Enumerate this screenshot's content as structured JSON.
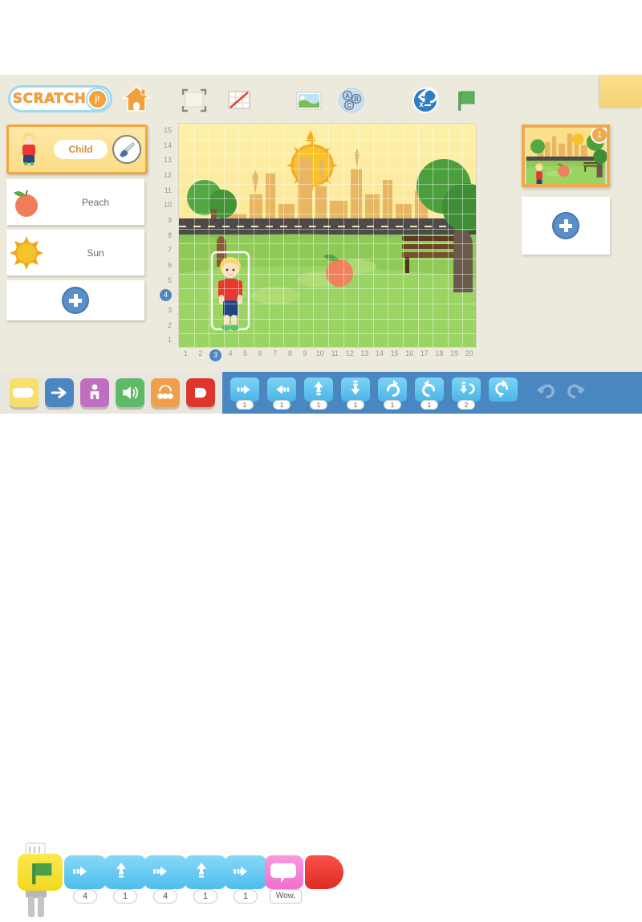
{
  "app": {
    "logo_text": "SCRATCH",
    "logo_badge": "jr"
  },
  "toolbar": {
    "home": "home-icon",
    "items": [
      {
        "name": "fullscreen-button",
        "icon": "fullscreen-icon"
      },
      {
        "name": "grid-toggle-button",
        "icon": "grid-icon"
      },
      {
        "name": "background-button",
        "icon": "image-icon"
      },
      {
        "name": "text-button",
        "icon": "abc-icon",
        "letters": [
          "A",
          "B",
          "C"
        ]
      },
      {
        "name": "reset-button",
        "icon": "reset-x-icon",
        "letter": "x"
      },
      {
        "name": "green-flag-button",
        "icon": "green-flag-icon"
      }
    ]
  },
  "characters": {
    "items": [
      {
        "name": "Child",
        "selected": true,
        "thumb": "boy-sprite"
      },
      {
        "name": "Peach",
        "selected": false,
        "thumb": "peach-sprite"
      },
      {
        "name": "Sun",
        "selected": false,
        "thumb": "sun-sprite"
      }
    ],
    "paint_icon": "paintbrush-icon",
    "add_label": "add-character-button"
  },
  "stage": {
    "x_axis": [
      "1",
      "2",
      "3",
      "4",
      "5",
      "6",
      "7",
      "8",
      "9",
      "10",
      "11",
      "12",
      "13",
      "14",
      "15",
      "16",
      "17",
      "18",
      "19",
      "20"
    ],
    "y_axis": [
      "15",
      "14",
      "13",
      "12",
      "11",
      "10",
      "9",
      "8",
      "7",
      "6",
      "5",
      "4",
      "3",
      "2",
      "1"
    ],
    "highlight_x": "3",
    "highlight_y": "4",
    "background_name": "city-park-background",
    "sprites": [
      "boy-sprite",
      "peach-sprite",
      "sun-sprite"
    ]
  },
  "pages": {
    "thumbs": [
      {
        "number": "1",
        "selected": true
      }
    ],
    "add_label": "add-page-button"
  },
  "categories": [
    {
      "name": "triggers",
      "color": "#f7df6b",
      "icon": "flag-block-icon"
    },
    {
      "name": "motion",
      "color": "#4a86c0",
      "icon": "arrow-right-icon"
    },
    {
      "name": "looks",
      "color": "#c06fc0",
      "icon": "person-icon"
    },
    {
      "name": "sound",
      "color": "#5dbb67",
      "icon": "speaker-icon"
    },
    {
      "name": "control",
      "color": "#f0a04a",
      "icon": "repeat-icon"
    },
    {
      "name": "end",
      "color": "#e0352c",
      "icon": "stop-icon"
    }
  ],
  "palette_blocks": [
    {
      "name": "move-right-block",
      "icon": "arrow-right",
      "value": "1"
    },
    {
      "name": "move-left-block",
      "icon": "arrow-left",
      "value": "1"
    },
    {
      "name": "move-up-block",
      "icon": "arrow-up",
      "value": "1"
    },
    {
      "name": "move-down-block",
      "icon": "arrow-down",
      "value": "1"
    },
    {
      "name": "turn-right-block",
      "icon": "rotate-cw",
      "value": "1"
    },
    {
      "name": "turn-left-block",
      "icon": "rotate-ccw",
      "value": "1"
    },
    {
      "name": "hop-block",
      "icon": "hop",
      "value": "2"
    },
    {
      "name": "go-home-block",
      "icon": "go-home",
      "value": ""
    }
  ],
  "palette_actions": [
    {
      "name": "undo-button",
      "icon": "undo-icon"
    },
    {
      "name": "redo-button",
      "icon": "redo-icon"
    }
  ],
  "script": {
    "blocks": [
      {
        "name": "start-on-green-flag",
        "type": "trigger",
        "icon": "green-flag",
        "value": ""
      },
      {
        "name": "move-right-block",
        "type": "motion",
        "icon": "arrow-right",
        "value": "4"
      },
      {
        "name": "move-up-block",
        "type": "motion",
        "icon": "arrow-up",
        "value": "1"
      },
      {
        "name": "move-right-block",
        "type": "motion",
        "icon": "arrow-right",
        "value": "4"
      },
      {
        "name": "move-up-block",
        "type": "motion",
        "icon": "arrow-up",
        "value": "1"
      },
      {
        "name": "move-right-block",
        "type": "motion",
        "icon": "arrow-right",
        "value": "1"
      },
      {
        "name": "say-block",
        "type": "looks",
        "icon": "speech-bubble",
        "value": "Wow,"
      },
      {
        "name": "end-block",
        "type": "end",
        "icon": "end-cap",
        "value": ""
      }
    ]
  },
  "colors": {
    "app_bg": "#ece9dd",
    "palette_blue": "#4a86c0",
    "accent_orange": "#f0a73c",
    "block_blue": "#4fbdec",
    "block_yellow": "#f2d81e",
    "block_pink": "#f06fd0",
    "block_red": "#e02b24"
  }
}
